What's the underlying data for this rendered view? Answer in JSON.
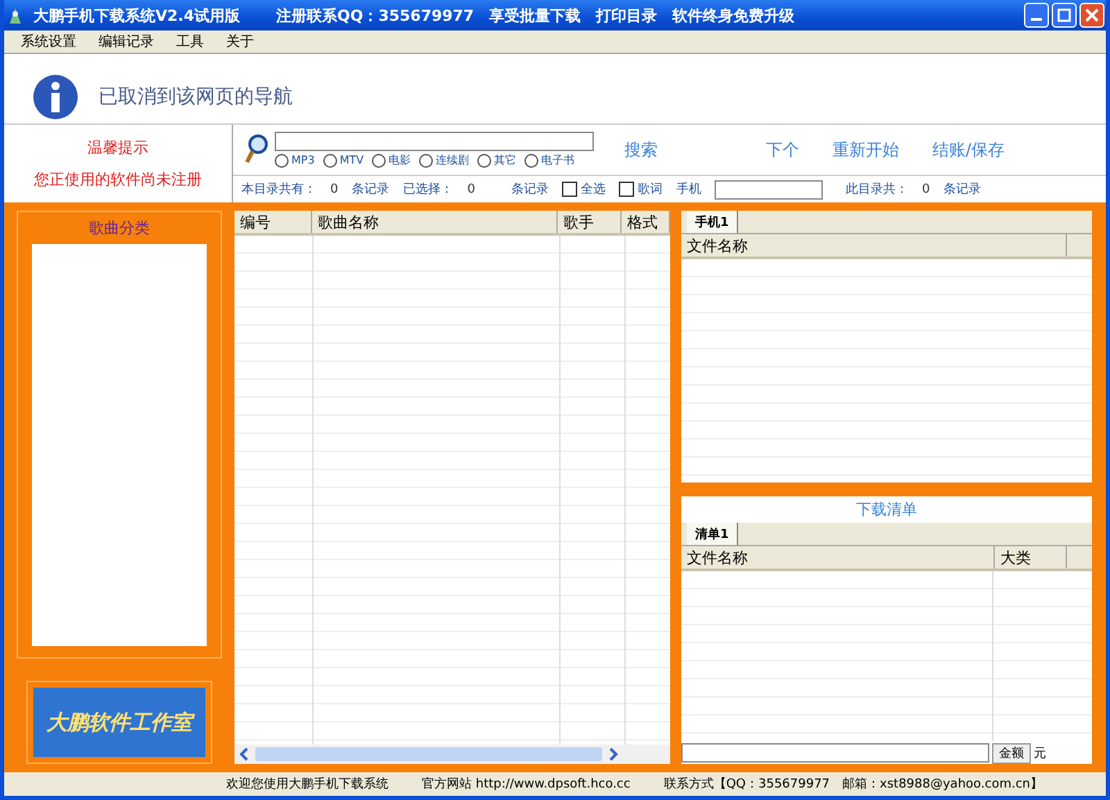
{
  "window": {
    "title": "大鹏手机下载系统V2.4试用版",
    "title_extra": "注册联系QQ：355679977　享受批量下载　打印目录　软件终身免费升级"
  },
  "menu": [
    "系统设置",
    "编辑记录",
    "工具",
    "关于"
  ],
  "browser_notice": "已取消到该网页的导航",
  "tip": {
    "title": "温馨提示",
    "text": "您正使用的软件尚未注册"
  },
  "search": {
    "types": [
      {
        "label": "MP3",
        "selected": false
      },
      {
        "label": "MTV",
        "selected": false
      },
      {
        "label": "电影",
        "selected": false
      },
      {
        "label": "连续剧",
        "selected": false
      },
      {
        "label": "其它",
        "selected": false
      },
      {
        "label": "电子书",
        "selected": false
      }
    ],
    "actions": [
      "搜索",
      "下个",
      "重新开始",
      "结账/保存"
    ]
  },
  "stats": {
    "total_label": "本目录共有：",
    "total": "0",
    "unit1": "条记录",
    "selected_label": "已选择：",
    "selected_count": "0",
    "unit2": "条记录",
    "checks": [
      {
        "label": "全选",
        "checked": false
      },
      {
        "label": "歌词",
        "checked": false
      }
    ],
    "phone_label": "手机",
    "this_label": "此目录共：",
    "this_count": "0",
    "unit3": "条记录"
  },
  "categories": {
    "title": "歌曲分类"
  },
  "logo": "大鹏软件工作室",
  "songs": {
    "columns": [
      "编号",
      "歌曲名称",
      "歌手",
      "格式"
    ]
  },
  "phone": {
    "tabs": [
      {
        "label": "手机1",
        "selected": true
      }
    ],
    "columns": [
      "文件名称"
    ]
  },
  "download": {
    "title": "下载清单",
    "tabs": [
      {
        "label": "清单1",
        "selected": true
      }
    ],
    "columns": [
      "文件名称",
      "大类"
    ],
    "amount_label": "金额",
    "amount_unit": "元"
  },
  "status_bar": [
    "欢迎您使用大鹏手机下载系统",
    "官方网站 http://www.dpsoft.hco.cc",
    "联系方式【QQ：355679977　邮箱：xst8988@yahoo.com.cn】"
  ]
}
